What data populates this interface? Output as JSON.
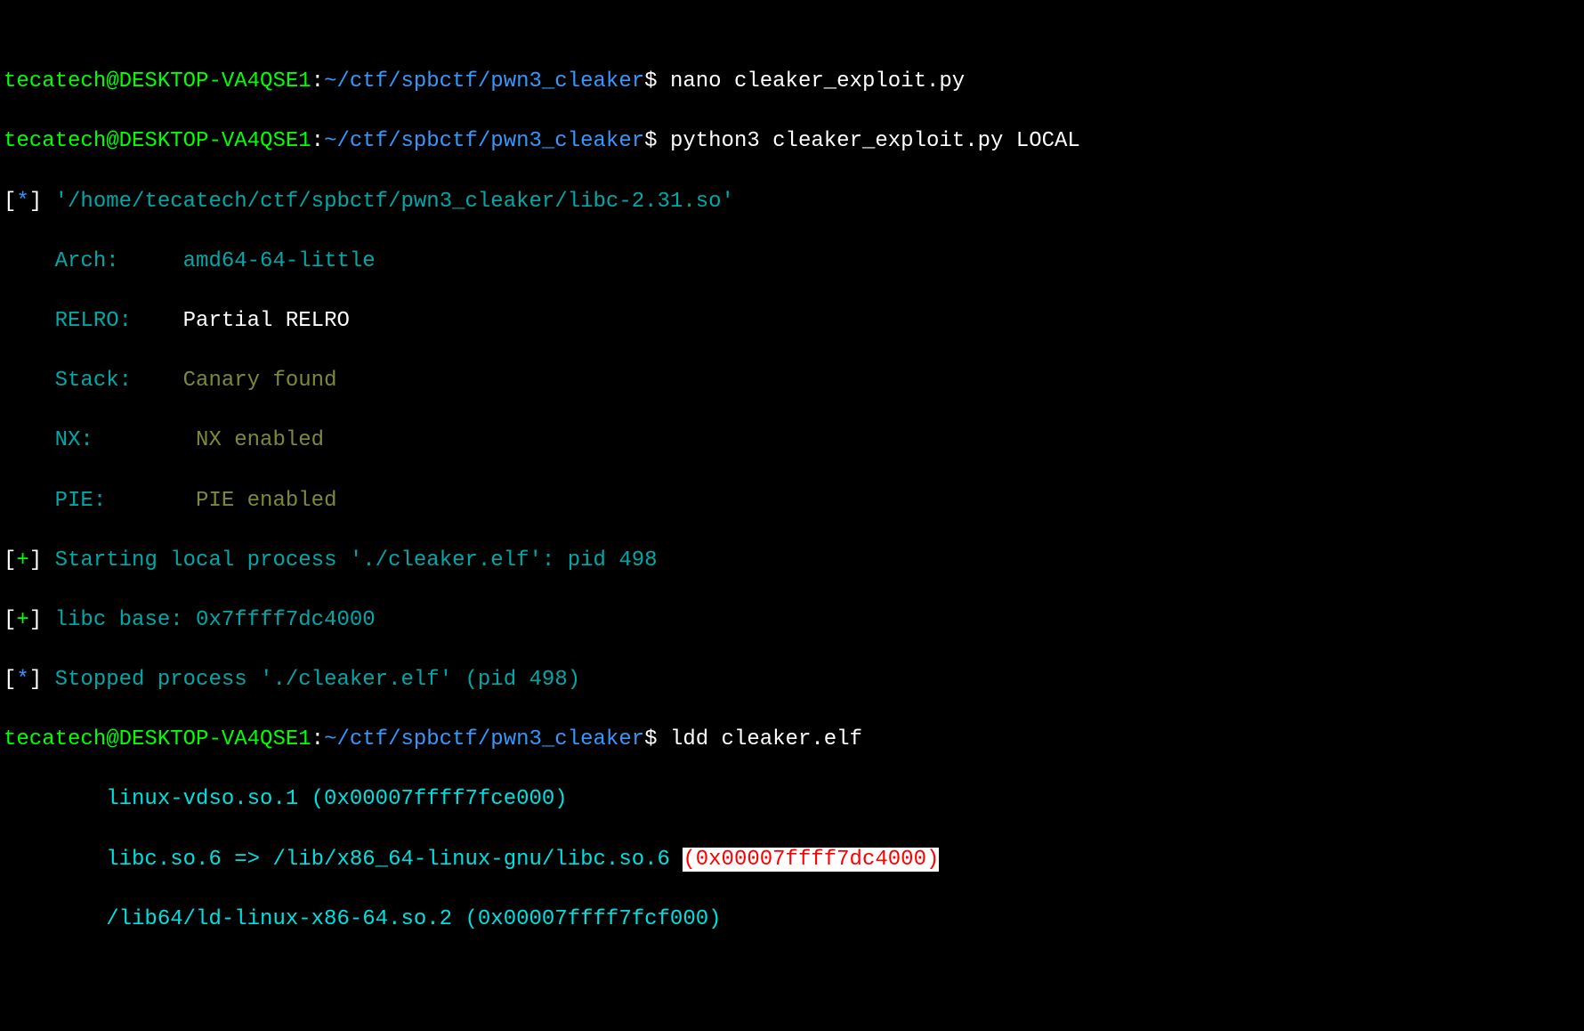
{
  "prompt": {
    "user": "tecatech@DESKTOP-VA4QSE1",
    "sep": ":",
    "path": "~/ctf/spbctf/pwn3_cleaker",
    "dollar": "$"
  },
  "cmd1": "nano cleaker_exploit.py",
  "cmd2": "python3 cleaker_exploit.py LOCAL",
  "libc_path": "'/home/tecatech/ctf/spbctf/pwn3_cleaker/libc-2.31.so'",
  "checksec": {
    "arch_label": "Arch:",
    "arch_value": "amd64-64-little",
    "relro_label": "RELRO:",
    "relro_value": "Partial RELRO",
    "stack_label": "Stack:",
    "stack_value": "Canary found",
    "nx_label": "NX:",
    "nx_value": "NX enabled",
    "pie_label": "PIE:",
    "pie_value": "PIE enabled"
  },
  "starting": "Starting local process './cleaker.elf': pid 498",
  "libc_base": "libc base: 0x7ffff7dc4000",
  "stopped": "Stopped process './cleaker.elf' (pid 498)",
  "cmd3": "ldd cleaker.elf",
  "ldd": {
    "vdso": "linux-vdso.so.1 (0x00007ffff7fce000)",
    "libc_prefix": "libc.so.6 => /lib/x86_64-linux-gnu/libc.so.6 ",
    "libc_addr": "(0x00007ffff7dc4000)",
    "ld": "/lib64/ld-linux-x86-64.so.2 (0x00007ffff7fcf000)"
  },
  "indent4": "    ",
  "indent8": "        ",
  "pad_arch": "     ",
  "pad_relro": "    ",
  "pad_stack": "    ",
  "pad_nx": "        ",
  "pad_pie": "       "
}
